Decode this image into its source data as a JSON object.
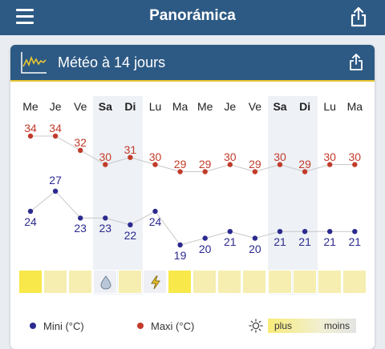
{
  "app": {
    "title": "Panorámica"
  },
  "card": {
    "title": "Météo à 14 jours"
  },
  "forecast": {
    "days": [
      {
        "day": "Me",
        "max": "34",
        "min": "24",
        "weekend": false,
        "condition": "sunny"
      },
      {
        "day": "Je",
        "max": "34",
        "min": "27",
        "weekend": false,
        "condition": "mild"
      },
      {
        "day": "Ve",
        "max": "32",
        "min": "23",
        "weekend": false,
        "condition": "mild"
      },
      {
        "day": "Sa",
        "max": "30",
        "min": "23",
        "weekend": true,
        "condition": "rain"
      },
      {
        "day": "Di",
        "max": "31",
        "min": "22",
        "weekend": true,
        "condition": "mild"
      },
      {
        "day": "Lu",
        "max": "30",
        "min": "24",
        "weekend": false,
        "condition": "storm"
      },
      {
        "day": "Ma",
        "max": "29",
        "min": "19",
        "weekend": false,
        "condition": "sunny"
      },
      {
        "day": "Me",
        "max": "29",
        "min": "20",
        "weekend": false,
        "condition": "mild"
      },
      {
        "day": "Je",
        "max": "30",
        "min": "21",
        "weekend": false,
        "condition": "mild"
      },
      {
        "day": "Ve",
        "max": "29",
        "min": "20",
        "weekend": false,
        "condition": "mild"
      },
      {
        "day": "Sa",
        "max": "30",
        "min": "21",
        "weekend": true,
        "condition": "mild"
      },
      {
        "day": "Di",
        "max": "29",
        "min": "21",
        "weekend": true,
        "condition": "mild"
      },
      {
        "day": "Lu",
        "max": "30",
        "min": "21",
        "weekend": false,
        "condition": "mild"
      },
      {
        "day": "Ma",
        "max": "30",
        "min": "21",
        "weekend": false,
        "condition": "mild"
      }
    ]
  },
  "legend": {
    "min_label": "Mini (°C)",
    "max_label": "Maxi (°C)",
    "scale_plus": "plus",
    "scale_moins": "moins"
  },
  "colors": {
    "header": "#2d5a84",
    "accent_line": "#e8c531",
    "max": "#c23b2a",
    "min": "#2b2a8f",
    "sunny": "#f8e84a",
    "mild": "#f5eeb0",
    "weekend_cond": "#eef0f6"
  },
  "icons": [
    "menu-icon",
    "share-icon",
    "chart-icon",
    "raindrop-icon",
    "lightning-icon",
    "sun-icon"
  ]
}
